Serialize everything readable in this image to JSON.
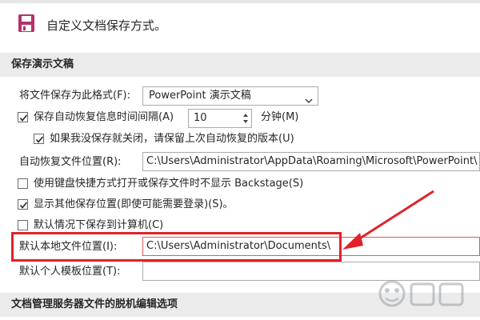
{
  "header": {
    "title": "自定义文档保存方式。"
  },
  "section_save": {
    "title": "保存演示文稿",
    "format_label": "将文件保存为此格式(F):",
    "format_value": "PowerPoint 演示文稿",
    "autorecover_label": "保存自动恢复信息时间间隔(A)",
    "autorecover_minutes": "10",
    "minutes_unit": "分钟(M)",
    "keep_last_label": "如果我没保存就关闭，请保留上次自动恢复的版本(U)",
    "autorecover_location_label": "自动恢复文件位置(R):",
    "autorecover_location_value": "C:\\Users\\Administrator\\AppData\\Roaming\\Microsoft\\PowerPoint\\",
    "no_backstage_label": "使用键盘快捷方式打开或保存文件时不显示 Backstage(S)",
    "show_other_locations_label": "显示其他保存位置(即使可能需要登录)(S)。",
    "save_to_computer_label": "默认情况下保存到计算机(C)",
    "default_local_label": "默认本地文件位置(I):",
    "default_local_value": "C:\\Users\\Administrator\\Documents\\",
    "personal_templates_label": "默认个人模板位置(T):",
    "personal_templates_value": ""
  },
  "checkboxes": {
    "autorecover": true,
    "keep_last": true,
    "no_backstage": false,
    "show_other_locations": true,
    "save_to_computer": false
  },
  "section_offline": {
    "title": "文档管理服务器文件的脱机编辑选项"
  },
  "annotation": {
    "highlight_color": "#e0222a"
  },
  "colors": {
    "section_band": "#ebebeb",
    "border": "#aaaaaa",
    "text": "#262626",
    "accent_red": "#e0222a"
  },
  "icons": {
    "header": "floppy-save-icon",
    "check": "checkmark-icon",
    "select": "chevron-down-icon",
    "spin": "spin-arrows-icon"
  }
}
